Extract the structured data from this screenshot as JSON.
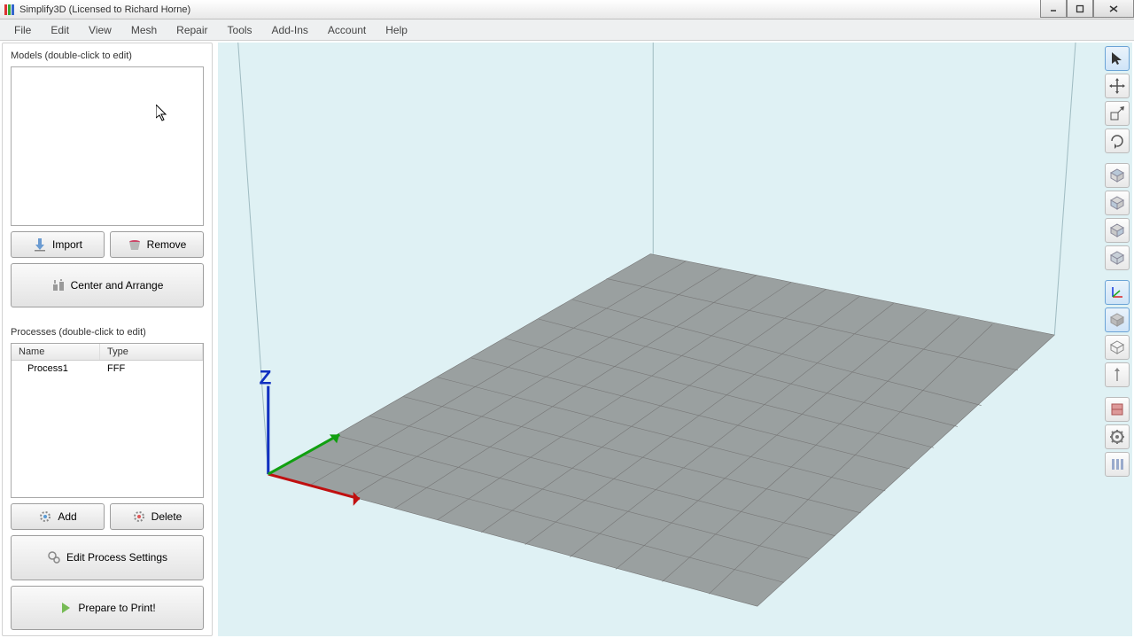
{
  "title": "Simplify3D (Licensed to Richard Horne)",
  "menu": [
    "File",
    "Edit",
    "View",
    "Mesh",
    "Repair",
    "Tools",
    "Add-Ins",
    "Account",
    "Help"
  ],
  "sidebar": {
    "models_label": "Models (double-click to edit)",
    "import_btn": "Import",
    "remove_btn": "Remove",
    "center_arrange_btn": "Center and Arrange",
    "processes_label": "Processes (double-click to edit)",
    "col_name": "Name",
    "col_type": "Type",
    "process_rows": [
      {
        "name": "Process1",
        "type": "FFF"
      }
    ],
    "add_btn": "Add",
    "delete_btn": "Delete",
    "edit_settings_btn": "Edit Process Settings",
    "prepare_btn": "Prepare to Print!"
  },
  "axis_label": "Z",
  "toolbar_icons": [
    "select",
    "move",
    "scale",
    "rotate",
    "view-top",
    "view-front",
    "view-side",
    "view-iso",
    "coord-system",
    "cross-section",
    "wireframe",
    "normals",
    "support",
    "settings",
    "machine-control"
  ]
}
